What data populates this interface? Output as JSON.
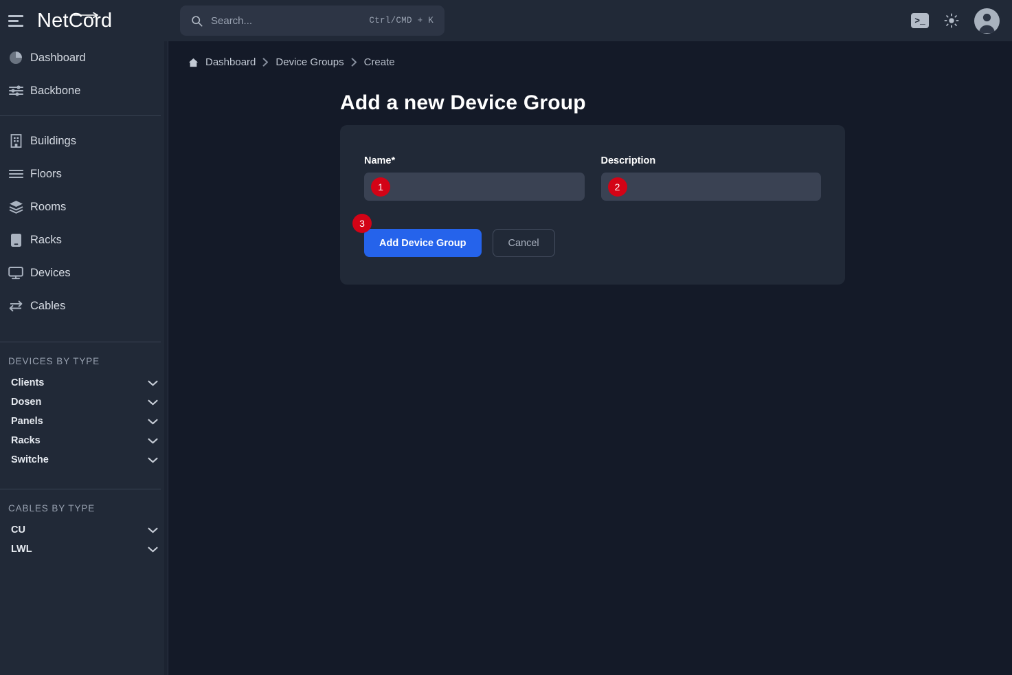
{
  "header": {
    "menu_icon": "hamburger-icon",
    "brand": "NetCord",
    "search": {
      "placeholder": "Search...",
      "shortcut": "Ctrl/CMD + K",
      "icon": "search-icon"
    },
    "actions": [
      {
        "name": "terminal-icon",
        "glyph": ">_"
      },
      {
        "name": "theme-toggle-icon",
        "glyph": "sun"
      },
      {
        "name": "user-avatar",
        "glyph": "person"
      }
    ]
  },
  "sidebar": {
    "primary": [
      {
        "label": "Dashboard",
        "icon": "pie-chart-icon"
      },
      {
        "label": "Backbone",
        "icon": "sliders-icon"
      }
    ],
    "secondary": [
      {
        "label": "Buildings",
        "icon": "building-icon"
      },
      {
        "label": "Floors",
        "icon": "layers-lines-icon"
      },
      {
        "label": "Rooms",
        "icon": "stack-icon"
      },
      {
        "label": "Racks",
        "icon": "rack-icon"
      },
      {
        "label": "Devices",
        "icon": "monitor-icon"
      },
      {
        "label": "Cables",
        "icon": "swap-arrows-icon"
      }
    ],
    "devices_by_type": {
      "title": "DEVICES BY TYPE",
      "items": [
        {
          "label": "Clients"
        },
        {
          "label": "Dosen"
        },
        {
          "label": "Panels"
        },
        {
          "label": "Racks"
        },
        {
          "label": "Switche"
        }
      ]
    },
    "cables_by_type": {
      "title": "CABLES BY TYPE",
      "items": [
        {
          "label": "CU"
        },
        {
          "label": "LWL"
        }
      ]
    }
  },
  "main": {
    "breadcrumb": [
      {
        "label": "Dashboard",
        "icon": "home-icon"
      },
      {
        "label": "Device Groups"
      },
      {
        "label": "Create"
      }
    ],
    "page_title": "Add a new Device Group",
    "form": {
      "name": {
        "label": "Name*",
        "value": "",
        "placeholder": ""
      },
      "description": {
        "label": "Description",
        "value": "",
        "placeholder": ""
      },
      "submit_label": "Add Device Group",
      "cancel_label": "Cancel"
    },
    "step_badges": [
      {
        "number": "1",
        "target": "name-input"
      },
      {
        "number": "2",
        "target": "description-input"
      },
      {
        "number": "3",
        "target": "add-device-group-button"
      }
    ]
  },
  "colors": {
    "background": "#141a28",
    "panel": "#212937",
    "input": "#3a4253",
    "accent": "#2563eb",
    "badge": "#d30316",
    "text": "#e6eaf0",
    "muted": "#98a1b0"
  }
}
